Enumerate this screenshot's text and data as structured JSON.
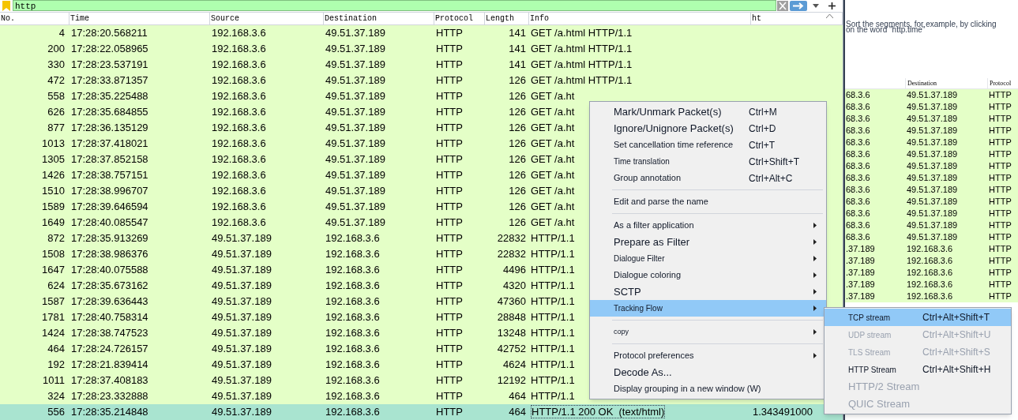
{
  "filter": {
    "value": "http"
  },
  "table": {
    "columns": [
      "No.",
      "Time",
      "Source",
      "Destination",
      "Protocol",
      "Length",
      "Info",
      "ht"
    ],
    "rows": [
      {
        "no": "4",
        "time": "17:28:20.568211",
        "source": "192.168.3.6",
        "destination": "49.51.37.189",
        "protocol": "HTTP",
        "length": "141",
        "info": "GET /a.html HTTP/1.1",
        "selected": false
      },
      {
        "no": "200",
        "time": "17:28:22.058965",
        "source": "192.168.3.6",
        "destination": "49.51.37.189",
        "protocol": "HTTP",
        "length": "141",
        "info": "GET /a.html HTTP/1.1",
        "selected": false
      },
      {
        "no": "330",
        "time": "17:28:23.537191",
        "source": "192.168.3.6",
        "destination": "49.51.37.189",
        "protocol": "HTTP",
        "length": "141",
        "info": "GET /a.html HTTP/1.1",
        "selected": false
      },
      {
        "no": "472",
        "time": "17:28:33.871357",
        "source": "192.168.3.6",
        "destination": "49.51.37.189",
        "protocol": "HTTP",
        "length": "126",
        "info": "GET /a.html HTTP/1.1",
        "selected": false
      },
      {
        "no": "558",
        "time": "17:28:35.225488",
        "source": "192.168.3.6",
        "destination": "49.51.37.189",
        "protocol": "HTTP",
        "length": "126",
        "info": "GET /a.ht",
        "selected": false
      },
      {
        "no": "626",
        "time": "17:28:35.684855",
        "source": "192.168.3.6",
        "destination": "49.51.37.189",
        "protocol": "HTTP",
        "length": "126",
        "info": "GET /a.ht",
        "selected": false
      },
      {
        "no": "877",
        "time": "17:28:36.135129",
        "source": "192.168.3.6",
        "destination": "49.51.37.189",
        "protocol": "HTTP",
        "length": "126",
        "info": "GET /a.ht",
        "selected": false
      },
      {
        "no": "1013",
        "time": "17:28:37.418021",
        "source": "192.168.3.6",
        "destination": "49.51.37.189",
        "protocol": "HTTP",
        "length": "126",
        "info": "GET /a.ht",
        "selected": false
      },
      {
        "no": "1305",
        "time": "17:28:37.852158",
        "source": "192.168.3.6",
        "destination": "49.51.37.189",
        "protocol": "HTTP",
        "length": "126",
        "info": "GET /a.ht",
        "selected": false
      },
      {
        "no": "1426",
        "time": "17:28:38.757151",
        "source": "192.168.3.6",
        "destination": "49.51.37.189",
        "protocol": "HTTP",
        "length": "126",
        "info": "GET /a.ht",
        "selected": false
      },
      {
        "no": "1510",
        "time": "17:28:38.996707",
        "source": "192.168.3.6",
        "destination": "49.51.37.189",
        "protocol": "HTTP",
        "length": "126",
        "info": "GET /a.ht",
        "selected": false
      },
      {
        "no": "1589",
        "time": "17:28:39.646594",
        "source": "192.168.3.6",
        "destination": "49.51.37.189",
        "protocol": "HTTP",
        "length": "126",
        "info": "GET /a.ht",
        "selected": false
      },
      {
        "no": "1649",
        "time": "17:28:40.085547",
        "source": "192.168.3.6",
        "destination": "49.51.37.189",
        "protocol": "HTTP",
        "length": "126",
        "info": "GET /a.ht",
        "selected": false
      },
      {
        "no": "872",
        "time": "17:28:35.913269",
        "source": "49.51.37.189",
        "destination": "192.168.3.6",
        "protocol": "HTTP",
        "length": "22832",
        "info": "HTTP/1.1",
        "selected": false
      },
      {
        "no": "1508",
        "time": "17:28:38.986376",
        "source": "49.51.37.189",
        "destination": "192.168.3.6",
        "protocol": "HTTP",
        "length": "22832",
        "info": "HTTP/1.1",
        "selected": false
      },
      {
        "no": "1647",
        "time": "17:28:40.075588",
        "source": "49.51.37.189",
        "destination": "192.168.3.6",
        "protocol": "HTTP",
        "length": "4496",
        "info": "HTTP/1.1",
        "selected": false
      },
      {
        "no": "624",
        "time": "17:28:35.673162",
        "source": "49.51.37.189",
        "destination": "192.168.3.6",
        "protocol": "HTTP",
        "length": "4320",
        "info": "HTTP/1.1",
        "selected": false
      },
      {
        "no": "1587",
        "time": "17:28:39.636443",
        "source": "49.51.37.189",
        "destination": "192.168.3.6",
        "protocol": "HTTP",
        "length": "47360",
        "info": "HTTP/1.1",
        "selected": false
      },
      {
        "no": "1781",
        "time": "17:28:40.758314",
        "source": "49.51.37.189",
        "destination": "192.168.3.6",
        "protocol": "HTTP",
        "length": "28848",
        "info": "HTTP/1.1",
        "selected": false
      },
      {
        "no": "1424",
        "time": "17:28:38.747523",
        "source": "49.51.37.189",
        "destination": "192.168.3.6",
        "protocol": "HTTP",
        "length": "13248",
        "info": "HTTP/1.1",
        "selected": false
      },
      {
        "no": "464",
        "time": "17:28:24.726157",
        "source": "49.51.37.189",
        "destination": "192.168.3.6",
        "protocol": "HTTP",
        "length": "42752",
        "info": "HTTP/1.1",
        "selected": false
      },
      {
        "no": "192",
        "time": "17:28:21.839414",
        "source": "49.51.37.189",
        "destination": "192.168.3.6",
        "protocol": "HTTP",
        "length": "4624",
        "info": "HTTP/1.1",
        "selected": false
      },
      {
        "no": "1011",
        "time": "17:28:37.408183",
        "source": "49.51.37.189",
        "destination": "192.168.3.6",
        "protocol": "HTTP",
        "length": "12192",
        "info": "HTTP/1.1",
        "selected": false
      },
      {
        "no": "324",
        "time": "17:28:23.332888",
        "source": "49.51.37.189",
        "destination": "192.168.3.6",
        "protocol": "HTTP",
        "length": "464",
        "info": "HTTP/1.1",
        "selected": false
      },
      {
        "no": "556",
        "time": "17:28:35.214848",
        "source": "49.51.37.189",
        "destination": "192.168.3.6",
        "protocol": "HTTP",
        "length": "464",
        "info": "HTTP/1.1 200 OK  (text/html)",
        "ht": "1.343491000",
        "selected": true
      }
    ]
  },
  "context_menu": {
    "items": [
      {
        "kind": "item",
        "label": "Mark/Unmark Packet(s)",
        "shortcut": "Ctrl+M",
        "submenu": false,
        "selected": false
      },
      {
        "kind": "item",
        "label": "Ignore/Unignore Packet(s)",
        "shortcut": "Ctrl+D",
        "submenu": false,
        "selected": false
      },
      {
        "kind": "item",
        "label": "Set cancellation time reference",
        "shortcut": "Ctrl+T",
        "submenu": false,
        "selected": false
      },
      {
        "kind": "item",
        "label": "Time translation",
        "shortcut": "Ctrl+Shift+T",
        "submenu": false,
        "selected": false
      },
      {
        "kind": "item",
        "label": "Group annotation",
        "shortcut": "Ctrl+Alt+C",
        "submenu": false,
        "selected": false
      },
      {
        "kind": "separator"
      },
      {
        "kind": "item",
        "label": "Edit and parse the name",
        "submenu": false,
        "selected": false
      },
      {
        "kind": "separator"
      },
      {
        "kind": "item",
        "label": "As a filter application",
        "submenu": true,
        "selected": false
      },
      {
        "kind": "item",
        "label": "Prepare as Filter",
        "submenu": true,
        "selected": false
      },
      {
        "kind": "item",
        "label": "Dialogue Filter",
        "submenu": true,
        "selected": false
      },
      {
        "kind": "item",
        "label": "Dialogue coloring",
        "submenu": true,
        "selected": false
      },
      {
        "kind": "item",
        "label": "SCTP",
        "submenu": true,
        "selected": false
      },
      {
        "kind": "item",
        "label": "Tracking Flow",
        "submenu": true,
        "selected": true
      },
      {
        "kind": "separator"
      },
      {
        "kind": "item",
        "label": "copy",
        "submenu": true,
        "selected": false
      },
      {
        "kind": "separator"
      },
      {
        "kind": "item",
        "label": "Protocol preferences",
        "submenu": true,
        "selected": false
      },
      {
        "kind": "item",
        "label": "Decode As...",
        "submenu": false,
        "selected": false
      },
      {
        "kind": "item",
        "label": "Display grouping in a new window (W)",
        "submenu": false,
        "selected": false
      }
    ]
  },
  "submenu": {
    "items": [
      {
        "label": "TCP stream",
        "shortcut": "Ctrl+Alt+Shift+T",
        "selected": true,
        "disabled": false
      },
      {
        "label": "UDP stream",
        "shortcut": "Ctrl+Alt+Shift+U",
        "selected": false,
        "disabled": true
      },
      {
        "label": "TLS Stream",
        "shortcut": "Ctrl+Alt+Shift+S",
        "selected": false,
        "disabled": true
      },
      {
        "label": "HTTP Stream",
        "shortcut": "Ctrl+Alt+Shift+H",
        "selected": false,
        "disabled": false
      },
      {
        "label": "HTTP/2 Stream",
        "selected": false,
        "disabled": true
      },
      {
        "label": "QUIC Stream",
        "selected": false,
        "disabled": true
      }
    ]
  },
  "background_window": {
    "hint": "Sort the segments, for example, by clicking on the word \"http.time\"",
    "columns": [
      "Destination",
      "Protocol"
    ],
    "rows": [
      {
        "column_1": "68.3.6",
        "destination": "49.51.37.189",
        "protocol": "HTTP"
      },
      {
        "column_1": "68.3.6",
        "destination": "49.51.37.189",
        "protocol": "HTTP"
      },
      {
        "column_1": "68.3.6",
        "destination": "49.51.37.189",
        "protocol": "HTTP"
      },
      {
        "column_1": "68.3.6",
        "destination": "49.51.37.189",
        "protocol": "HTTP"
      },
      {
        "column_1": "68.3.6",
        "destination": "49.51.37.189",
        "protocol": "HTTP"
      },
      {
        "column_1": "68.3.6",
        "destination": "49.51.37.189",
        "protocol": "HTTP"
      },
      {
        "column_1": "68.3.6",
        "destination": "49.51.37.189",
        "protocol": "HTTP"
      },
      {
        "column_1": "68.3.6",
        "destination": "49.51.37.189",
        "protocol": "HTTP"
      },
      {
        "column_1": "68.3.6",
        "destination": "49.51.37.189",
        "protocol": "HTTP"
      },
      {
        "column_1": "68.3.6",
        "destination": "49.51.37.189",
        "protocol": "HTTP"
      },
      {
        "column_1": "68.3.6",
        "destination": "49.51.37.189",
        "protocol": "HTTP"
      },
      {
        "column_1": "68.3.6",
        "destination": "49.51.37.189",
        "protocol": "HTTP"
      },
      {
        "column_1": "68.3.6",
        "destination": "49.51.37.189",
        "protocol": "HTTP"
      },
      {
        "column_1": ".37.189",
        "destination": "192.168.3.6",
        "protocol": "HTTP"
      },
      {
        "column_1": ".37.189",
        "destination": "192.168.3.6",
        "protocol": "HTTP"
      },
      {
        "column_1": ".37.189",
        "destination": "192.168.3.6",
        "protocol": "HTTP"
      },
      {
        "column_1": ".37.189",
        "destination": "192.168.3.6",
        "protocol": "HTTP"
      },
      {
        "column_1": ".37.189",
        "destination": "192.168.3.6",
        "protocol": "HTTP"
      }
    ]
  }
}
